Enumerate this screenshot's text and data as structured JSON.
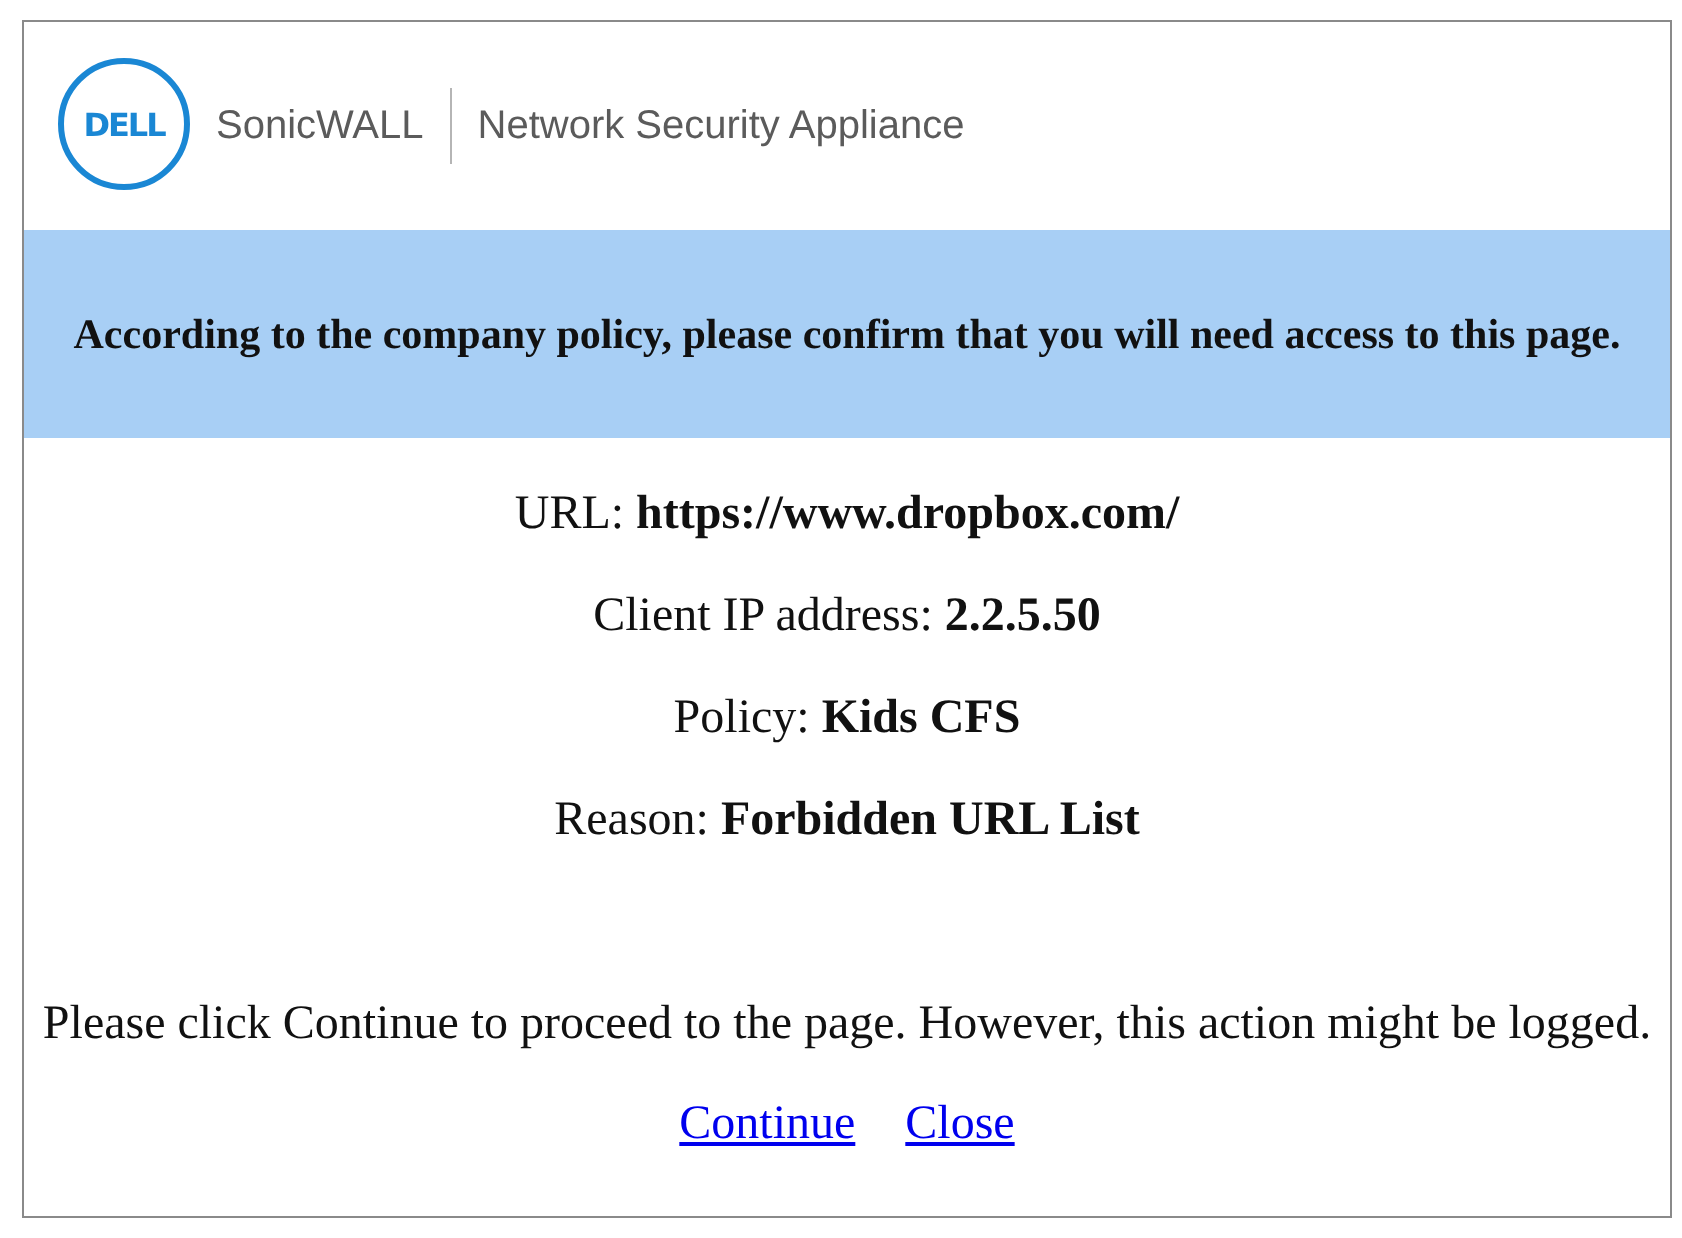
{
  "header": {
    "logo_text": "DELL",
    "product": "SonicWALL",
    "subtitle": "Network Security Appliance"
  },
  "notice": {
    "message": "According to the company policy, please confirm that you will need access to this page."
  },
  "details": [
    {
      "label": "URL:",
      "value": "https://www.dropbox.com/"
    },
    {
      "label": "Client IP address:",
      "value": "2.2.5.50"
    },
    {
      "label": "Policy:",
      "value": "Kids CFS"
    },
    {
      "label": "Reason:",
      "value": "Forbidden URL List"
    }
  ],
  "prompt": "Please click Continue to proceed to the page. However, this action might be logged.",
  "links": [
    {
      "label": "Continue"
    },
    {
      "label": "Close"
    }
  ]
}
